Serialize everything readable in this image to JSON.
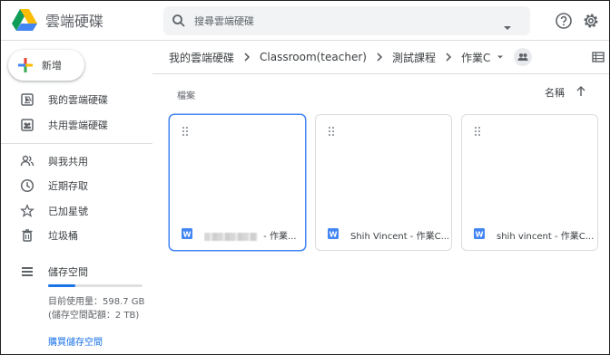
{
  "app": {
    "title": "雲端硬碟"
  },
  "search": {
    "placeholder": "搜尋雲端硬碟"
  },
  "new_button": {
    "label": "新增"
  },
  "sidebar": {
    "items": [
      {
        "label": "我的雲端硬碟",
        "icon": "my-drive-icon"
      },
      {
        "label": "共用雲端硬碟",
        "icon": "shared-drives-icon"
      },
      {
        "label": "與我共用",
        "icon": "shared-with-me-icon"
      },
      {
        "label": "近期存取",
        "icon": "clock-icon"
      },
      {
        "label": "已加星號",
        "icon": "star-icon"
      },
      {
        "label": "垃圾桶",
        "icon": "trash-icon"
      }
    ],
    "storage": {
      "label": "儲存空間",
      "used_text": "目前使用量：598.7 GB",
      "quota_text": "(儲存空間配額：2 TB)",
      "buy_label": "購買儲存空間",
      "used_fraction": 0.29
    }
  },
  "breadcrumb": {
    "items": [
      "我的雲端硬碟",
      "Classroom(teacher)",
      "測試課程",
      "作業C"
    ]
  },
  "main": {
    "section_label": "檔案",
    "sort_label": "名稱",
    "files": [
      {
        "name": " - 作業...",
        "selected": true
      },
      {
        "name": "Shih Vincent - 作業C...",
        "selected": false
      },
      {
        "name": "shih vincent - 作業C...",
        "selected": false
      }
    ]
  },
  "colors": {
    "accent": "#1a73e8",
    "word": "#4285f4",
    "selected_border": "#4285f4"
  }
}
